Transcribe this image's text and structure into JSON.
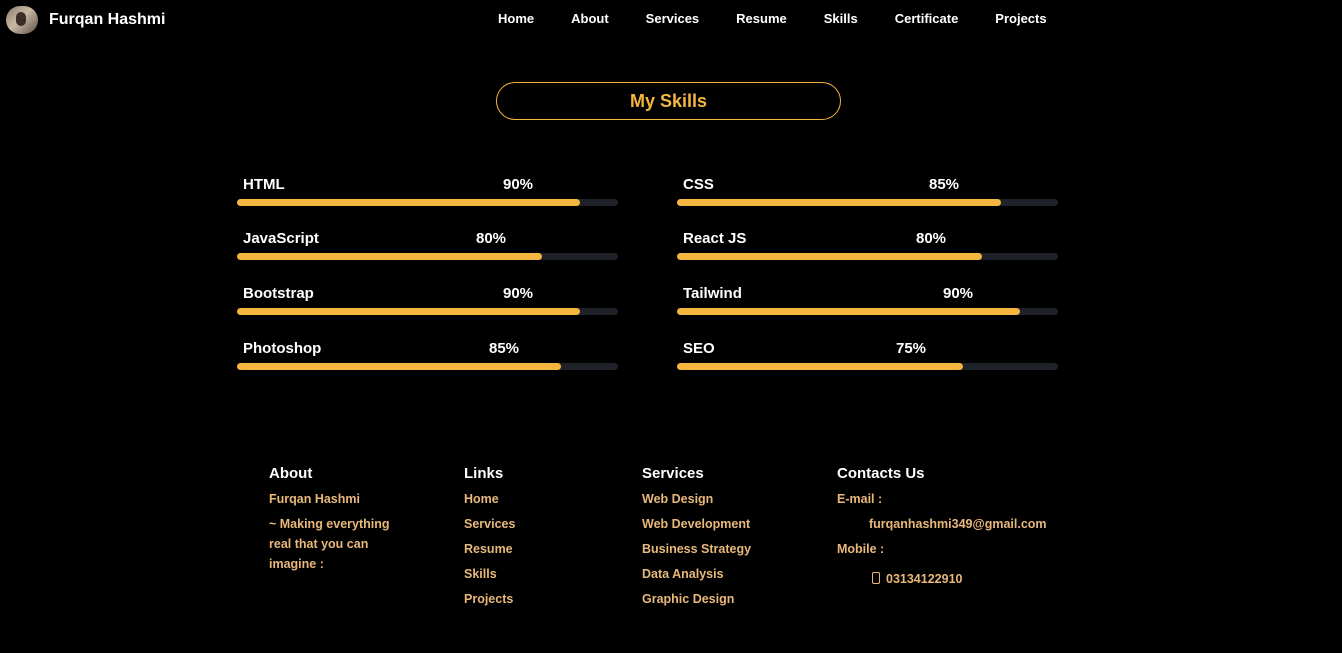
{
  "brand": {
    "name": "Furqan Hashmi"
  },
  "nav": [
    "Home",
    "About",
    "Services",
    "Resume",
    "Skills",
    "Certificate",
    "Projects"
  ],
  "skills_section": {
    "title": "My Skills"
  },
  "skills": [
    {
      "name": "HTML",
      "percent_label": "90%",
      "level": 0.9
    },
    {
      "name": "CSS",
      "percent_label": "85%",
      "level": 0.85
    },
    {
      "name": "JavaScript",
      "percent_label": "80%",
      "level": 0.8
    },
    {
      "name": "React JS",
      "percent_label": "80%",
      "level": 0.8
    },
    {
      "name": "Bootstrap",
      "percent_label": "90%",
      "level": 0.9
    },
    {
      "name": "Tailwind",
      "percent_label": "90%",
      "level": 0.9
    },
    {
      "name": "Photoshop",
      "percent_label": "85%",
      "level": 0.85
    },
    {
      "name": "SEO",
      "percent_label": "75%",
      "level": 0.75
    }
  ],
  "colors": {
    "accent": "#f4b63e",
    "footer_text": "#e8b87a",
    "track": "#1f2228",
    "background": "#000000"
  },
  "footer": {
    "about": {
      "heading": "About",
      "name": "Furqan Hashmi",
      "tagline": "~ Making everything real that you can imagine :"
    },
    "links": {
      "heading": "Links",
      "items": [
        "Home",
        "Services",
        "Resume",
        "Skills",
        "Projects"
      ]
    },
    "services": {
      "heading": "Services",
      "items": [
        "Web Design",
        "Web Development",
        "Business Strategy",
        "Data Analysis",
        "Graphic Design"
      ]
    },
    "contacts": {
      "heading": "Contacts Us",
      "email_label": "E-mail :",
      "email": "furqanhashmi349@gmail.com",
      "mobile_label": "Mobile :",
      "mobile": "03134122910",
      "phone_icon": "phone-icon"
    }
  }
}
